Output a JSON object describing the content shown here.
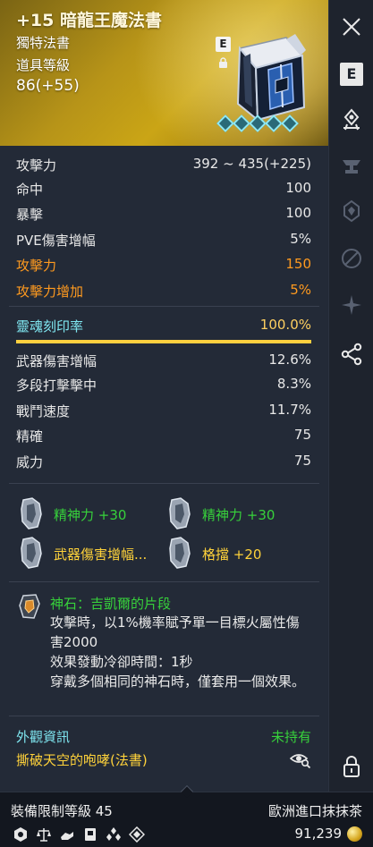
{
  "item": {
    "name": "+15 暗龍王魔法書",
    "rarity": "獨特法書",
    "level_label": "道具等級",
    "level_value": "86(+55)",
    "engrave_badge": "E",
    "gem_count": 5
  },
  "stats_main": [
    {
      "label": "攻擊力",
      "value": "392 ~ 435(+225)",
      "tone": "white"
    },
    {
      "label": "命中",
      "value": "100",
      "tone": "white"
    },
    {
      "label": "暴擊",
      "value": "100",
      "tone": "white"
    },
    {
      "label": "PVE傷害增幅",
      "value": "5%",
      "tone": "white"
    },
    {
      "label": "攻擊力",
      "value": "150",
      "tone": "orange"
    },
    {
      "label": "攻擊力增加",
      "value": "5%",
      "tone": "orange"
    }
  ],
  "soul_engrave": {
    "label": "靈魂刻印率",
    "value": "100.0%",
    "fill": 1.0
  },
  "stats_sub": [
    {
      "label": "武器傷害增幅",
      "value": "12.6%"
    },
    {
      "label": "多段打擊擊中",
      "value": "8.3%"
    },
    {
      "label": "戰鬥速度",
      "value": "11.7%"
    },
    {
      "label": "精確",
      "value": "75"
    },
    {
      "label": "威力",
      "value": "75"
    }
  ],
  "bonuses": [
    {
      "text": "精神力 +30",
      "tone": "green"
    },
    {
      "text": "精神力 +30",
      "tone": "green"
    },
    {
      "text": "武器傷害增幅...",
      "tone": "yellow"
    },
    {
      "text": "格擋 +20",
      "tone": "yellow"
    }
  ],
  "godstone": {
    "title": "神石：吉凱爾的片段",
    "description": "攻擊時，以1%機率賦予單一目標火屬性傷害2000\n效果發動冷卻時間：1秒\n穿戴多個相同的神石時，僅套用一個效果。"
  },
  "appearance": {
    "label": "外觀資訊",
    "status": "未持有",
    "skin_name": "撕破天空的咆哮(法書)"
  },
  "footer": {
    "requirement": "裝備限制等級 45",
    "seller": "歐洲進口抹抹茶",
    "price": "91,239"
  },
  "sidebar": {
    "engrave_label": "E"
  },
  "colors": {
    "header_gold": "#b79418",
    "orange": "#ff9a1f",
    "cyan": "#7fe6f0",
    "green": "#37d13b",
    "yellow": "#ffd23a",
    "bar_fill": "#ffcf3f"
  }
}
